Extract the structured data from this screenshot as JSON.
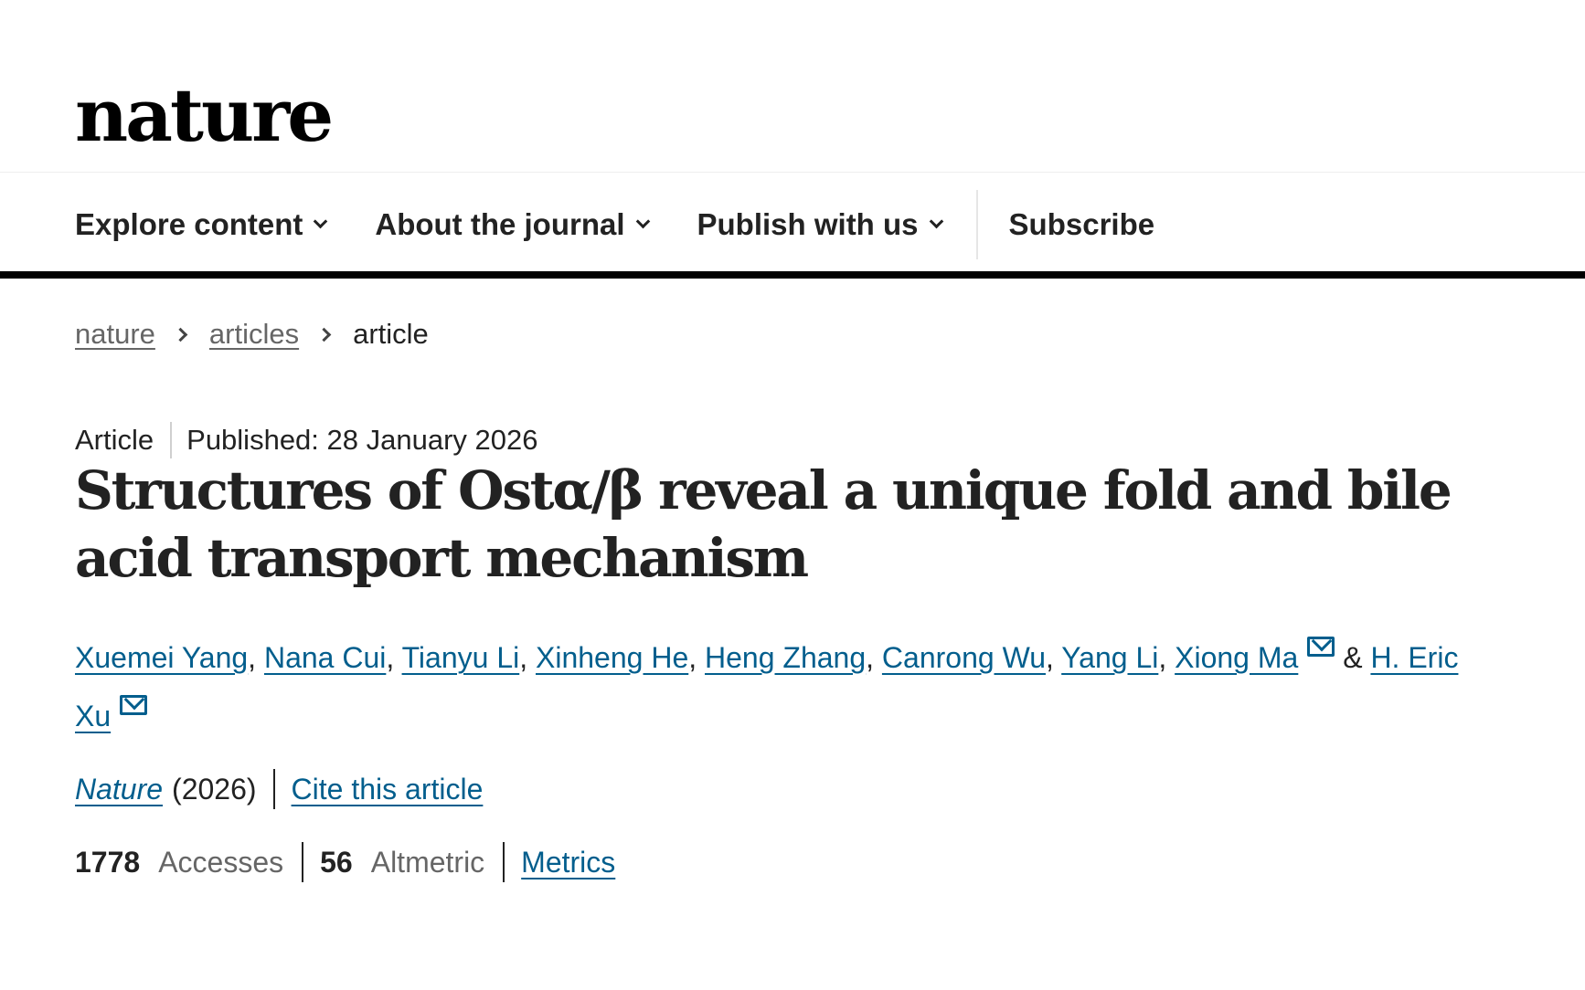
{
  "header": {
    "logo_text": "nature"
  },
  "nav": {
    "items": [
      {
        "label": "Explore content",
        "has_dropdown": true
      },
      {
        "label": "About the journal",
        "has_dropdown": true
      },
      {
        "label": "Publish with us",
        "has_dropdown": true
      },
      {
        "label": "Subscribe",
        "has_dropdown": false
      }
    ]
  },
  "breadcrumb": {
    "items": [
      "nature",
      "articles",
      "article"
    ]
  },
  "article": {
    "type": "Article",
    "published": "Published: 28 January 2026",
    "title": "Structures of Ostα/β reveal a unique fold and bile acid transport mechanism",
    "authors": [
      {
        "name": "Xuemei Yang"
      },
      {
        "name": "Nana Cui"
      },
      {
        "name": "Tianyu Li"
      },
      {
        "name": "Xinheng He"
      },
      {
        "name": "Heng Zhang"
      },
      {
        "name": "Canrong Wu"
      },
      {
        "name": "Yang Li"
      },
      {
        "name": "Xiong Ma",
        "corresponding": true
      },
      {
        "name": "H. Eric Xu",
        "corresponding": true
      }
    ],
    "author_separator": ", ",
    "author_last_joiner": " & ",
    "journal": "Nature",
    "year": "(2026)",
    "cite_label": "Cite this article"
  },
  "metrics": {
    "accesses_value": "1778",
    "accesses_label": "Accesses",
    "altmetric_value": "56",
    "altmetric_label": "Altmetric",
    "metrics_link": "Metrics"
  },
  "colors": {
    "link": "#025e8d",
    "text": "#222222",
    "muted": "#666666",
    "rule": "#000000"
  }
}
